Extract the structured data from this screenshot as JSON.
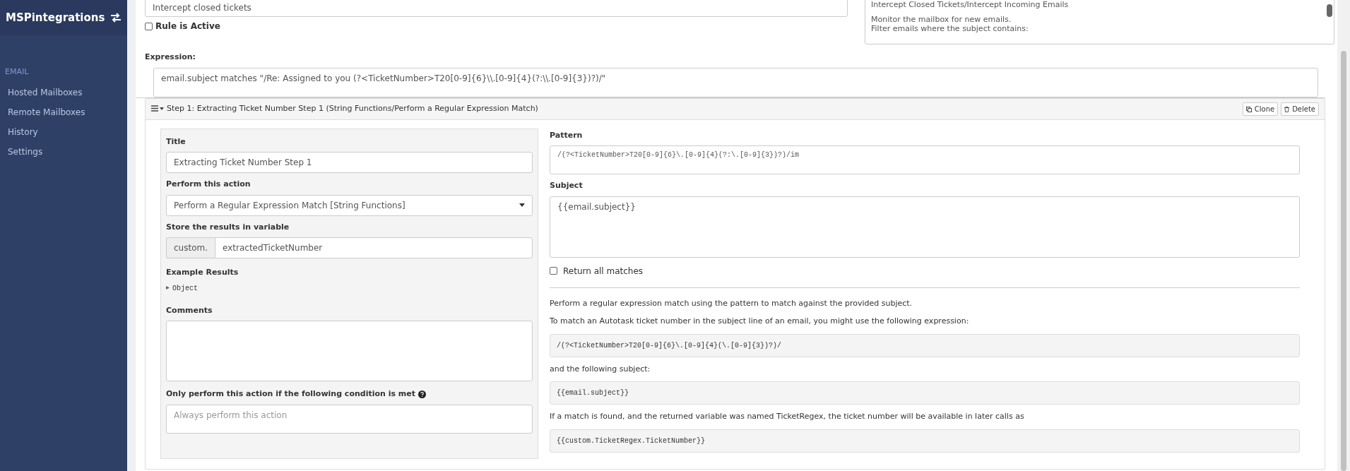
{
  "sidebar": {
    "brand": "MSPintegrations",
    "section": "EMAIL",
    "items": [
      {
        "label": "Hosted Mailboxes",
        "selected": false
      },
      {
        "label": "Remote Mailboxes",
        "selected": false
      },
      {
        "label": "History",
        "selected": false
      },
      {
        "label": "Settings",
        "selected": false
      }
    ]
  },
  "rule": {
    "name_value": "Intercept closed tickets",
    "active": {
      "label": "Rule is Active",
      "checked": false
    },
    "description_paragraphs": [
      "Intercept Closed Tickets/Intercept Incoming Emails",
      "Monitor the mailbox for new emails.\nFilter emails where the subject contains:"
    ],
    "expression_label": "Expression:",
    "expression_value": "email.subject matches \"/Re: Assigned to you (?<TicketNumber>T20[0-9]{6}\\\\.[0-9]{4}(?:\\\\.[0-9]{3})?)/\""
  },
  "step": {
    "title": "Step 1: Extracting Ticket Number Step 1 (String Functions/Perform a Regular Expression Match)",
    "buttons": [
      {
        "label": "Clone",
        "kind": "clone"
      },
      {
        "label": "Delete",
        "kind": "delete"
      }
    ],
    "title_label": "Title",
    "title_value": "Extracting Ticket Number Step 1",
    "action_label": "Perform this action",
    "action_value": "Perform a Regular Expression Match [String Functions]",
    "variable_label": "Store the results in variable",
    "variable_prefix": "custom.",
    "variable_value": "extractedTicketNumber",
    "example_label": "Example Results",
    "example_value": "Object",
    "example_expanded": false,
    "comments_label": "Comments",
    "condition_label": "Only perform this action if the following condition is met",
    "condition_placeholder": "Always perform this action",
    "pattern_label": "Pattern",
    "pattern_value": "/(?<TicketNumber>T20[0-9]{6}\\.[0-9]{4}(?:\\.[0-9]{3})?)/im",
    "subject_label": "Subject",
    "subject_value": "{{email.subject}}",
    "return_all": {
      "label": "Return all matches",
      "checked": false
    },
    "help": [
      {
        "kind": "text",
        "text": "Perform a regular expression match using the pattern to match against the provided subject."
      },
      {
        "kind": "text",
        "text": "To match an Autotask ticket number in the subject line of an email, you might use the following expression:"
      },
      {
        "kind": "code",
        "text": "/(?<TicketNumber>T20[0-9]{6}\\.[0-9]{4}(\\.[0-9]{3})?)/"
      },
      {
        "kind": "text",
        "text": "and the following subject:"
      },
      {
        "kind": "code",
        "text": "{{email.subject}}"
      },
      {
        "kind": "text",
        "text": "If a match is found, and the returned variable was named TicketRegex, the ticket number will be available in later calls as"
      },
      {
        "kind": "code",
        "text": "{{custom.TicketRegex.TicketNumber}}"
      }
    ]
  }
}
